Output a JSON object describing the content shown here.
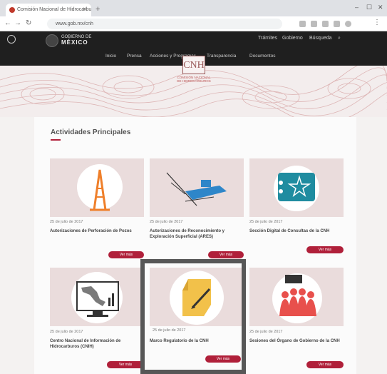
{
  "browser": {
    "tab_title": "Comisión Nacional de Hidrocarburos",
    "address": "www.gob.mx/cnh",
    "colors": {
      "accent": "#b0203a"
    }
  },
  "header": {
    "gobierno_top": "GOBIERNO DE",
    "gobierno_main": "MÉXICO",
    "nav": [
      "Trámites",
      "Gobierno",
      "Búsqueda"
    ],
    "subnav": [
      "Inicio",
      "Prensa",
      "Acciones y Programas",
      "Transparencia",
      "Documentos"
    ]
  },
  "banner": {
    "logo": "CNH",
    "subtitle": "COMISIÓN NACIONAL DE HIDROCARBUROS"
  },
  "section": {
    "title": "Actividades Principales"
  },
  "cards": [
    {
      "icon": "oil-rig-icon",
      "date": "25 de julio de 2017",
      "title": "Autorizaciones de Perforación de Pozos",
      "button": "Ver más"
    },
    {
      "icon": "seismic-ship-icon",
      "date": "25 de julio de 2017",
      "title": "Autorizaciones de Reconocimiento y Exploración Superficial (ARES)",
      "button": "Ver más"
    },
    {
      "icon": "digital-seal-icon",
      "date": "25 de julio de 2017",
      "title": "Sección Digital de Consultas de la CNH",
      "button": "Ver más"
    },
    {
      "icon": "map-monitor-icon",
      "date": "25 de julio de 2017",
      "title": "Centro Nacional de Información de Hidrocarburos (CNIH)",
      "button": "Ver más"
    },
    {
      "icon": "regulatory-document-icon",
      "date": "25 de julio de 2017",
      "title": "Marco Regulatorio de la CNH",
      "button": "Ver más"
    },
    {
      "icon": "governing-body-icon",
      "date": "25 de julio de 2017",
      "title": "Sesiones del Órgano de Gobierno de la CNH",
      "button": "Ver más"
    }
  ]
}
